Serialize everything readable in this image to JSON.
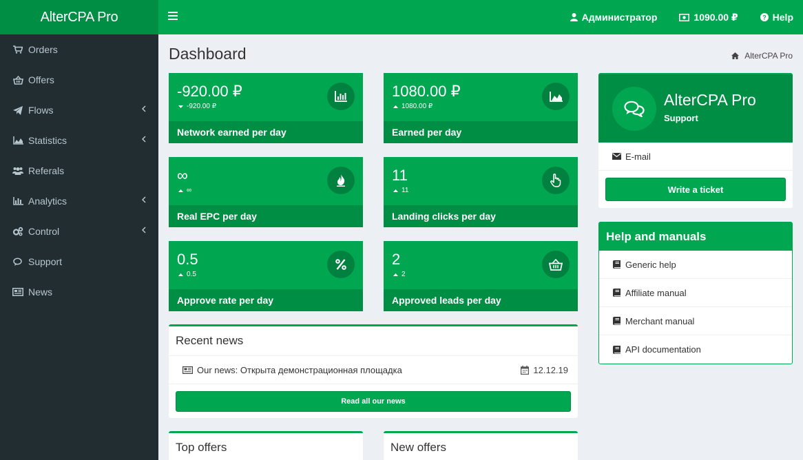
{
  "header": {
    "logo": "AlterCPA Pro",
    "user": "Администратор",
    "balance": "1090.00 ₽",
    "help": "Help"
  },
  "sidebar": {
    "items": [
      {
        "label": "Orders",
        "icon": "cart-icon",
        "has_children": false
      },
      {
        "label": "Offers",
        "icon": "basket-icon",
        "has_children": false
      },
      {
        "label": "Flows",
        "icon": "paper-plane-icon",
        "has_children": true
      },
      {
        "label": "Statistics",
        "icon": "area-chart-icon",
        "has_children": true
      },
      {
        "label": "Referals",
        "icon": "users-icon",
        "has_children": false
      },
      {
        "label": "Analytics",
        "icon": "bar-chart-icon",
        "has_children": true
      },
      {
        "label": "Control",
        "icon": "cogs-icon",
        "has_children": true
      },
      {
        "label": "Support",
        "icon": "comments-icon",
        "has_children": false
      },
      {
        "label": "News",
        "icon": "newspaper-icon",
        "has_children": false
      }
    ]
  },
  "page": {
    "title": "Dashboard",
    "breadcrumb": "AlterCPA Pro"
  },
  "stats": [
    {
      "value": "-920.00 ₽",
      "change": "-920.00 ₽",
      "trend": "down",
      "label": "Network earned per day",
      "icon": "bar-chart-icon"
    },
    {
      "value": "1080.00 ₽",
      "change": "1080.00 ₽",
      "trend": "up",
      "label": "Earned per day",
      "icon": "area-chart-icon"
    },
    {
      "value": "∞",
      "change": "∞",
      "trend": "up",
      "label": "Real EPC per day",
      "icon": "fire-icon"
    },
    {
      "value": "11",
      "change": "11",
      "trend": "up",
      "label": "Landing clicks per day",
      "icon": "pointer-hand-icon"
    },
    {
      "value": "0.5",
      "change": "0.5",
      "trend": "up",
      "label": "Approve rate per day",
      "icon": "percent-icon"
    },
    {
      "value": "2",
      "change": "2",
      "trend": "up",
      "label": "Approved leads per day",
      "icon": "basket-icon"
    }
  ],
  "recent_news": {
    "title": "Recent news",
    "items": [
      {
        "prefix": "Our news:",
        "title": "Открыта демонстрационная площадка",
        "date": "12.12.19"
      }
    ],
    "read_all": "Read all our news"
  },
  "top_offers": {
    "title": "Top offers"
  },
  "new_offers": {
    "title": "New offers"
  },
  "support": {
    "name": "AlterCPA Pro",
    "role": "Support",
    "email": "E-mail",
    "ticket_button": "Write a ticket"
  },
  "help_manuals": {
    "title": "Help and manuals",
    "items": [
      "Generic help",
      "Affiliate manual",
      "Merchant manual",
      "API documentation"
    ]
  },
  "colors": {
    "brand": "#00a650",
    "brand_dark": "#008d44",
    "sidebar_bg": "#222d32",
    "sidebar_text": "#b8c7ce",
    "content_bg": "#ecf0f5"
  }
}
